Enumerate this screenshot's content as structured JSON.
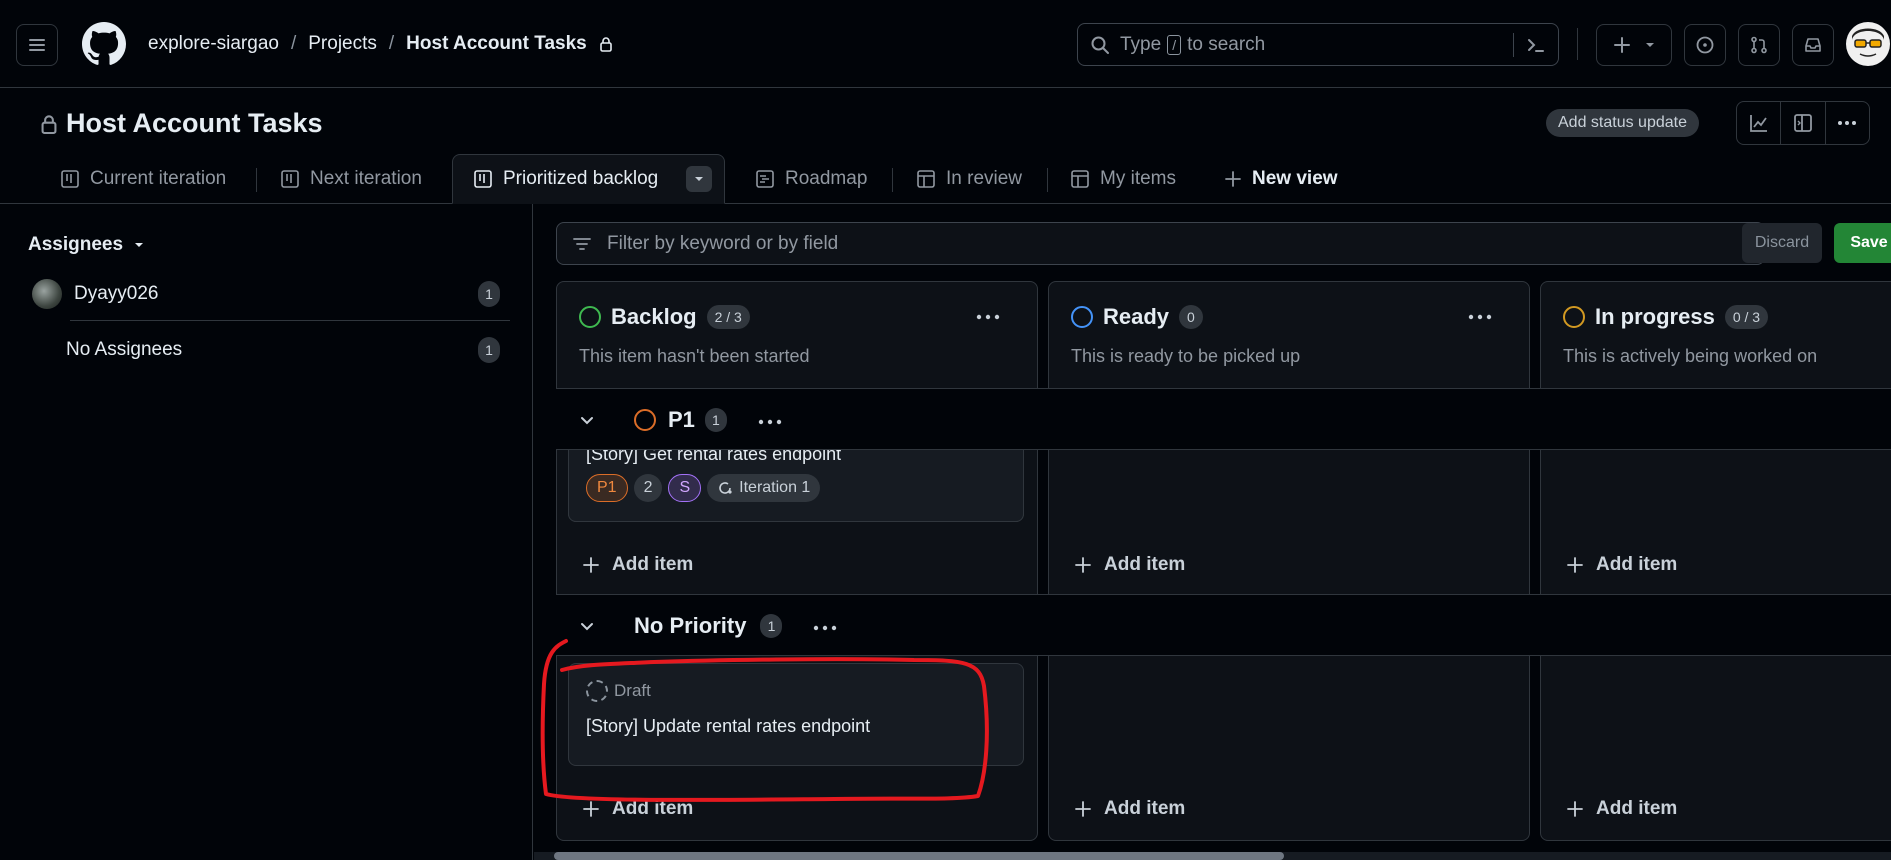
{
  "header": {
    "breadcrumbs": [
      "explore-siargao",
      "Projects",
      "Host Account Tasks"
    ],
    "search_prefix": "Type",
    "search_key": "/",
    "search_suffix": "to search"
  },
  "project": {
    "title": "Host Account Tasks",
    "status_button": "Add status update"
  },
  "tabs": [
    {
      "label": "Current iteration"
    },
    {
      "label": "Next iteration"
    },
    {
      "label": "Prioritized backlog",
      "active": true
    },
    {
      "label": "Roadmap"
    },
    {
      "label": "In review"
    },
    {
      "label": "My items"
    },
    {
      "label": "New view"
    }
  ],
  "sidebar": {
    "heading": "Assignees",
    "items": [
      {
        "label": "Dyayy026",
        "count": "1"
      },
      {
        "label": "No Assignees",
        "count": "1"
      }
    ]
  },
  "filter": {
    "placeholder": "Filter by keyword or by field",
    "discard": "Discard",
    "save": "Save"
  },
  "columns": [
    {
      "name": "Backlog",
      "count": "2 / 3",
      "description": "This item hasn't been started",
      "color": "#3fb950"
    },
    {
      "name": "Ready",
      "count": "0",
      "description": "This is ready to be picked up",
      "color": "#4493f8"
    },
    {
      "name": "In progress",
      "count": "0 / 3",
      "description": "This is actively being worked on",
      "color": "#d29922"
    }
  ],
  "groups": [
    {
      "name": "P1",
      "count": "1",
      "color": "#db6d28",
      "card": {
        "title": "[Story] Get rental rates endpoint",
        "labels": [
          "P1",
          "2",
          "S",
          "Iteration 1"
        ]
      }
    },
    {
      "name": "No Priority",
      "count": "1",
      "card": {
        "status": "Draft",
        "title": "[Story] Update rental rates endpoint"
      }
    }
  ],
  "add_item": "Add item",
  "colors": {
    "background": "#010409",
    "panel": "#0d1117",
    "border": "#30363d",
    "save_green": "#238636",
    "annotation_red": "#e5191f"
  }
}
